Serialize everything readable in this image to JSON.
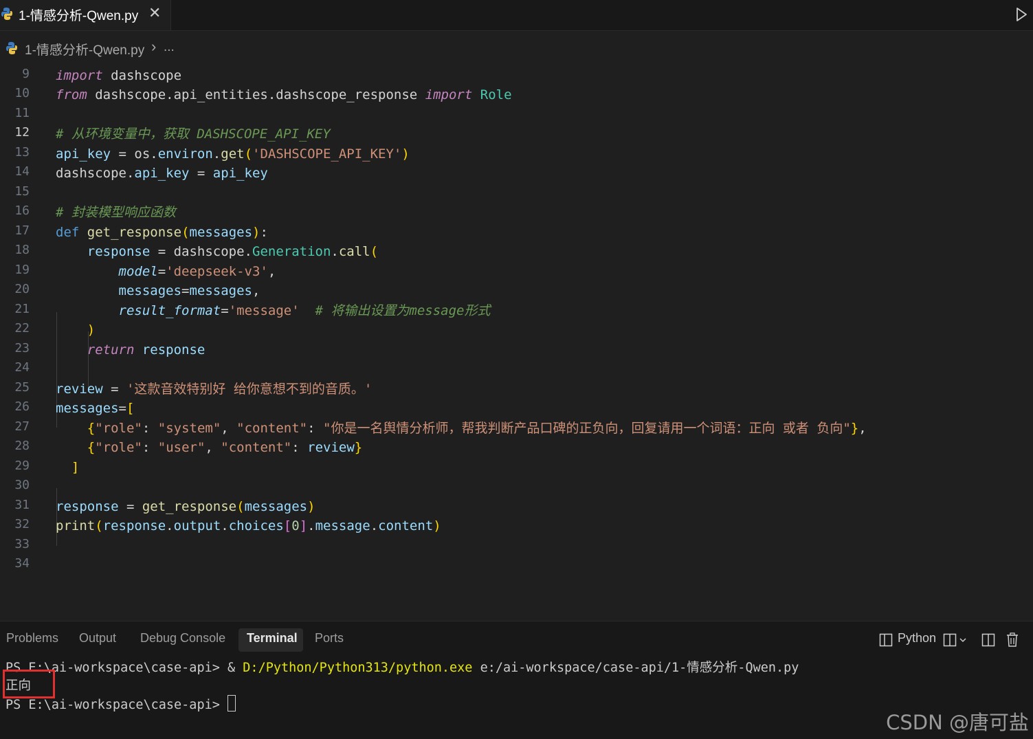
{
  "tab": {
    "label": "1-情感分析-Qwen.py",
    "close": "✕"
  },
  "breadcrumb": {
    "file": "1-情感分析-Qwen.py",
    "separator": "›",
    "more": "..."
  },
  "editor": {
    "active_line": 12,
    "line_numbers": [
      "9",
      "10",
      "11",
      "12",
      "13",
      "14",
      "15",
      "16",
      "17",
      "18",
      "19",
      "20",
      "21",
      "22",
      "23",
      "24",
      "25",
      "26",
      "27",
      "28",
      "29",
      "30",
      "31",
      "32",
      "33",
      "34"
    ],
    "code_text": [
      "import dashscope",
      "from dashscope.api_entities.dashscope_response import Role",
      "",
      "# 从环境变量中，获取 DASHSCOPE_API_KEY",
      "api_key = os.environ.get('DASHSCOPE_API_KEY')",
      "dashscope.api_key = api_key",
      "",
      "# 封装模型响应函数",
      "def get_response(messages):",
      "    response = dashscope.Generation.call(",
      "        model='deepseek-v3',",
      "        messages=messages,",
      "        result_format='message'  # 将输出设置为message形式",
      "    )",
      "    return response",
      "",
      "review = '这款音效特别好 给你意想不到的音质。'",
      "messages=[",
      "    {\"role\": \"system\", \"content\": \"你是一名舆情分析师，帮我判断产品口碑的正负向，回复请用一个词语：正向 或者 负向\"},",
      "    {\"role\": \"user\", \"content\": review}",
      "  ]",
      "",
      "response = get_response(messages)",
      "print(response.output.choices[0].message.content)",
      "",
      ""
    ]
  },
  "panel": {
    "tabs": [
      "Problems",
      "Output",
      "Debug Console",
      "Terminal",
      "Ports"
    ],
    "active_tab": "Terminal",
    "profile": "Python"
  },
  "terminal": {
    "line1_prompt": "PS E:\\ai-workspace\\case-api> ",
    "line1_amp": "& ",
    "line1_exe": "D:/Python/Python313/python.exe",
    "line1_arg": " e:/ai-workspace/case-api/1-情感分析-Qwen.py",
    "output": "正向",
    "line3_prompt": "PS E:\\ai-workspace\\case-api> "
  },
  "watermark": "CSDN @唐可盐",
  "colors": {
    "background": "#1f1f1f",
    "highlight_box": "#e03030"
  }
}
